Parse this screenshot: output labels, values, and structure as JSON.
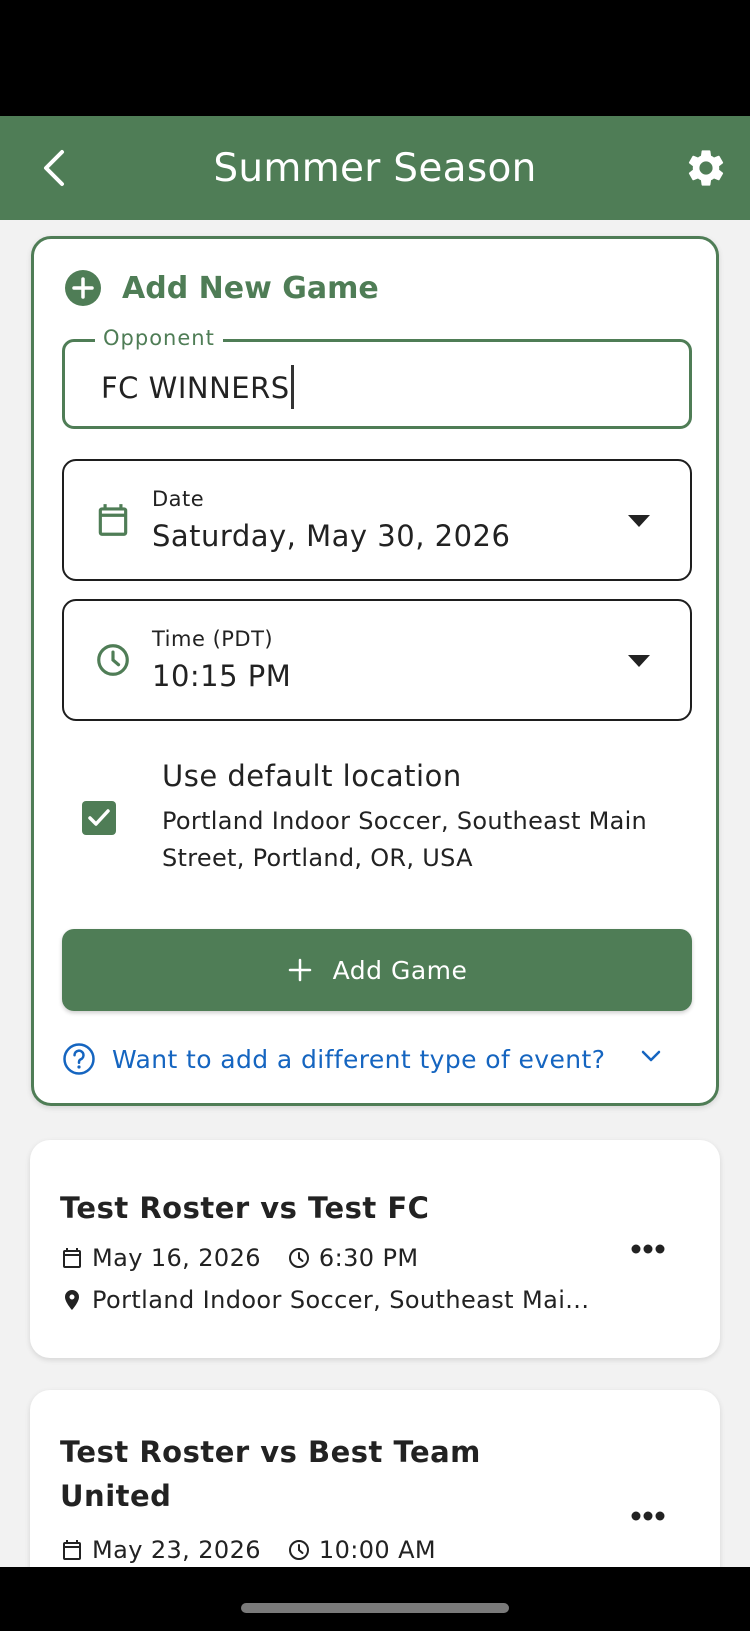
{
  "app_bar": {
    "title": "Summer Season"
  },
  "add_game": {
    "header": "Add New Game",
    "opponent": {
      "label": "Opponent",
      "value": "FC WINNERS"
    },
    "date": {
      "label": "Date",
      "value": "Saturday, May 30, 2026"
    },
    "time": {
      "label": "Time (PDT)",
      "value": "10:15 PM"
    },
    "location": {
      "checked": true,
      "title": "Use default location",
      "address": "Portland Indoor Soccer, Southeast Main Street, Portland, OR, USA"
    },
    "add_button": "Add Game",
    "other_event": "Want to add a different type of event?"
  },
  "games": [
    {
      "title": "Test Roster vs Test FC",
      "date": "May 16, 2026",
      "time": "6:30 PM",
      "location": "Portland Indoor Soccer, Southeast Mai..."
    },
    {
      "title": "Test Roster vs Best Team United",
      "date": "May 23, 2026",
      "time": "10:00 AM"
    }
  ],
  "colors": {
    "primary": "#4f7d56",
    "link": "#1565c0"
  }
}
